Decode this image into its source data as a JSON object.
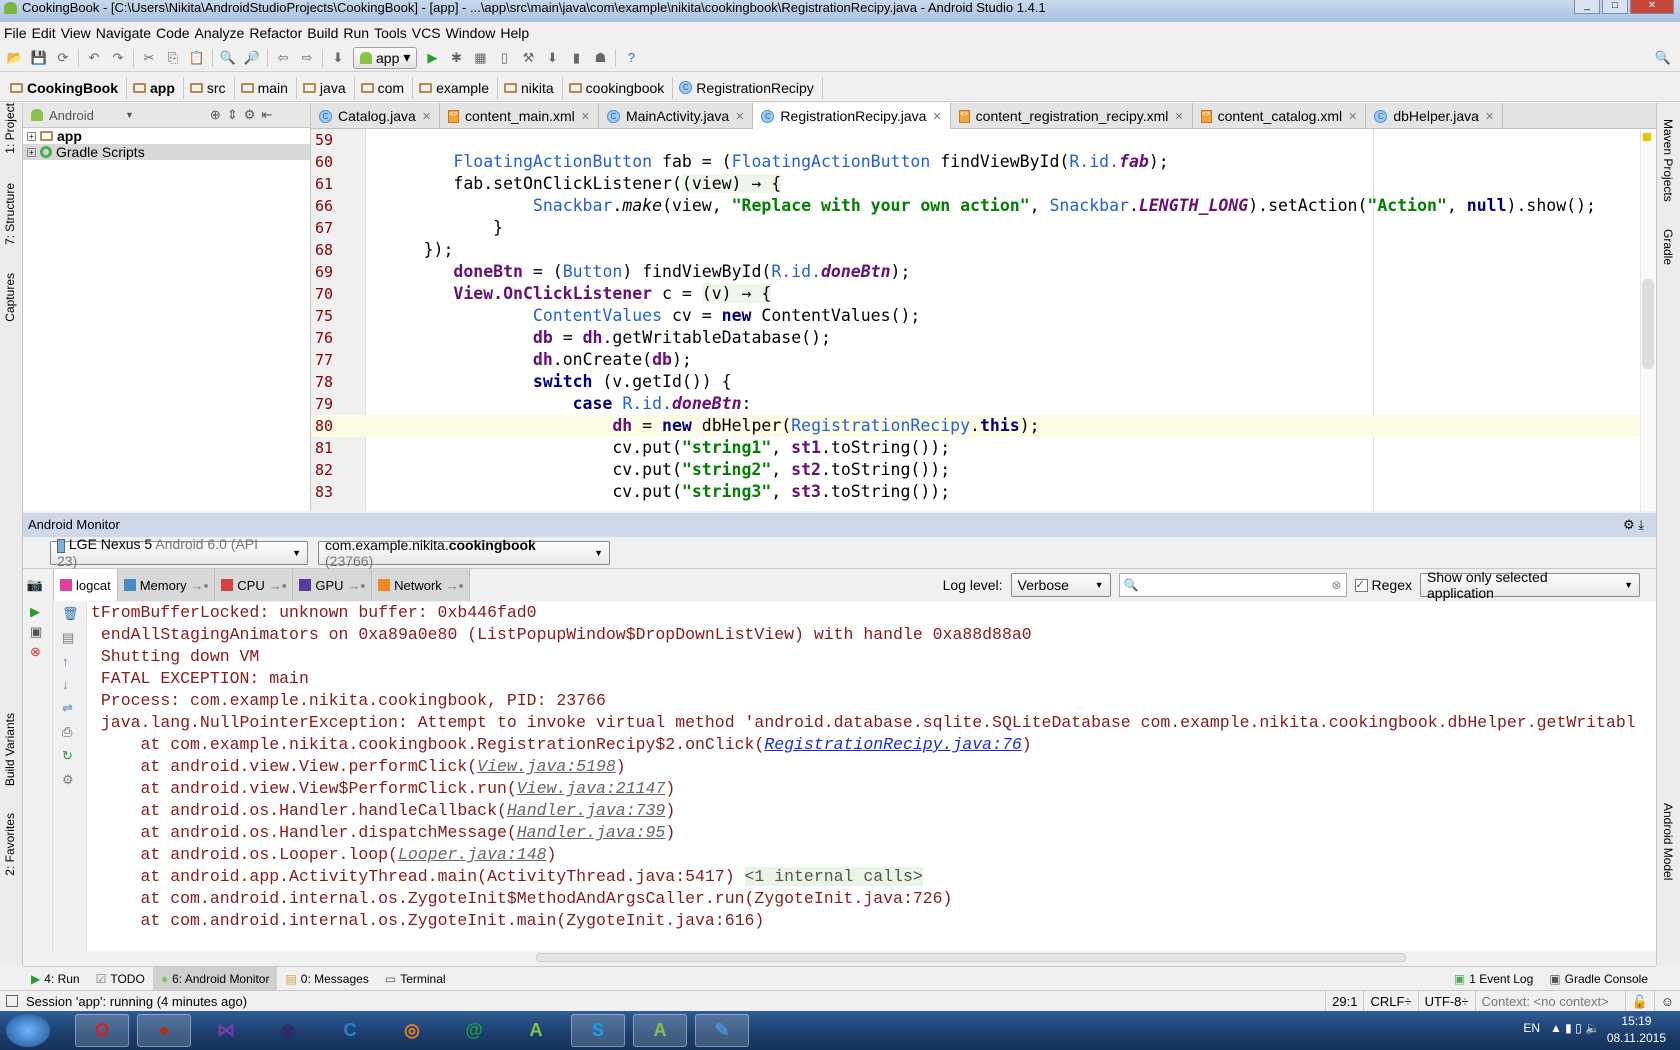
{
  "window": {
    "title": "CookingBook - [C:\\Users\\Nikita\\AndroidStudioProjects\\CookingBook] - [app] - ...\\app\\src\\main\\java\\com\\example\\nikita\\cookingbook\\RegistrationRecipy.java - Android Studio 1.4.1"
  },
  "menu": [
    "File",
    "Edit",
    "View",
    "Navigate",
    "Code",
    "Analyze",
    "Refactor",
    "Build",
    "Run",
    "Tools",
    "VCS",
    "Window",
    "Help"
  ],
  "toolbar": {
    "run_config": "app",
    "icons": [
      "open-icon",
      "save-icon",
      "sync-icon",
      "undo-icon",
      "redo-icon",
      "cut-icon",
      "copy-icon",
      "paste-icon",
      "find-icon",
      "replace-icon",
      "back-icon",
      "forward-icon",
      "make-icon",
      "run-icon",
      "debug-icon",
      "coverage-icon",
      "attach-debugger-icon",
      "project-structure-icon",
      "sdk-manager-icon",
      "avd-manager-icon",
      "android-device-monitor-icon",
      "help-icon"
    ]
  },
  "breadcrumb": [
    {
      "label": "CookingBook",
      "bold": true,
      "icon": "folder"
    },
    {
      "label": "app",
      "bold": true,
      "icon": "folder"
    },
    {
      "label": "src",
      "icon": "folder"
    },
    {
      "label": "main",
      "icon": "folder"
    },
    {
      "label": "java",
      "icon": "folder"
    },
    {
      "label": "com",
      "icon": "folder"
    },
    {
      "label": "example",
      "icon": "folder"
    },
    {
      "label": "nikita",
      "icon": "folder"
    },
    {
      "label": "cookingbook",
      "icon": "folder"
    },
    {
      "label": "RegistrationRecipy",
      "icon": "class"
    }
  ],
  "left_strip": [
    "1: Project",
    "7: Structure",
    "Captures",
    "Build Variants",
    "2: Favorites"
  ],
  "right_strip": [
    "Maven Projects",
    "Gradle",
    "Android Model"
  ],
  "project": {
    "view_mode": "Android",
    "tree": [
      {
        "label": "app",
        "bold": true
      },
      {
        "label": "Gradle Scripts"
      }
    ]
  },
  "tabs": [
    {
      "label": "Catalog.java",
      "icon": "class"
    },
    {
      "label": "content_main.xml",
      "icon": "xml"
    },
    {
      "label": "MainActivity.java",
      "icon": "class"
    },
    {
      "label": "RegistrationRecipy.java",
      "icon": "class",
      "active": true
    },
    {
      "label": "content_registration_recipy.xml",
      "icon": "xml"
    },
    {
      "label": "content_catalog.xml",
      "icon": "xml"
    },
    {
      "label": "dbHelper.java",
      "icon": "class"
    }
  ],
  "editor": {
    "current_line": "80",
    "lines": [
      {
        "n": "59",
        "t": []
      },
      {
        "n": "60",
        "t": [
          [
            "",
            "         "
          ],
          [
            "type",
            "FloatingActionButton"
          ],
          [
            "",
            " fab = ("
          ],
          [
            "type",
            "FloatingActionButton"
          ],
          [
            "",
            " findViewById("
          ],
          [
            "type",
            "R.id."
          ],
          [
            "sfield",
            "fab"
          ],
          [
            "",
            ");"
          ]
        ]
      },
      {
        "n": "61",
        "t": [
          [
            "",
            "         fab.setOnClickListener("
          ],
          [
            "lambda",
            "(view) → {"
          ]
        ]
      },
      {
        "n": "66",
        "t": [
          [
            "",
            "                 "
          ],
          [
            "type",
            "Snackbar"
          ],
          [
            "",
            "."
          ],
          [
            "italic",
            "make"
          ],
          [
            "",
            "(view, "
          ],
          [
            "str",
            "\"Replace with your own action\""
          ],
          [
            "",
            ", "
          ],
          [
            "type",
            "Snackbar"
          ],
          [
            "",
            "."
          ],
          [
            "sfield",
            "LENGTH_LONG"
          ],
          [
            "",
            ").setAction("
          ],
          [
            "str",
            "\"Action\""
          ],
          [
            "",
            ", "
          ],
          [
            "kw",
            "null"
          ],
          [
            "",
            ").show();"
          ]
        ]
      },
      {
        "n": "67",
        "t": [
          [
            "",
            "             }"
          ]
        ]
      },
      {
        "n": "68",
        "t": [
          [
            "",
            "      });"
          ]
        ]
      },
      {
        "n": "69",
        "t": [
          [
            "",
            "         "
          ],
          [
            "field",
            "doneBtn"
          ],
          [
            "",
            " = ("
          ],
          [
            "type",
            "Button"
          ],
          [
            "",
            ") findViewById("
          ],
          [
            "type",
            "R.id."
          ],
          [
            "sfield",
            "doneBtn"
          ],
          [
            "",
            ");"
          ]
        ]
      },
      {
        "n": "70",
        "t": [
          [
            "",
            "         "
          ],
          [
            "field",
            "View.OnClickListener"
          ],
          [
            "",
            " c = "
          ],
          [
            "lambda",
            "(v) → {"
          ]
        ]
      },
      {
        "n": "75",
        "t": [
          [
            "",
            "                 "
          ],
          [
            "type",
            "ContentValues"
          ],
          [
            "",
            " cv = "
          ],
          [
            "kw",
            "new"
          ],
          [
            "",
            " ContentValues();"
          ]
        ]
      },
      {
        "n": "76",
        "t": [
          [
            "",
            "                 "
          ],
          [
            "field",
            "db"
          ],
          [
            "",
            " = "
          ],
          [
            "field",
            "dh"
          ],
          [
            "",
            ".getWritableDatabase();"
          ]
        ]
      },
      {
        "n": "77",
        "t": [
          [
            "",
            "                 "
          ],
          [
            "field",
            "dh"
          ],
          [
            "",
            ".onCreate("
          ],
          [
            "field",
            "db"
          ],
          [
            "",
            ");"
          ]
        ]
      },
      {
        "n": "78",
        "t": [
          [
            "",
            "                 "
          ],
          [
            "kw",
            "switch"
          ],
          [
            "",
            " (v.getId()) {"
          ]
        ]
      },
      {
        "n": "79",
        "t": [
          [
            "",
            "                     "
          ],
          [
            "kw",
            "case"
          ],
          [
            "",
            " "
          ],
          [
            "type",
            "R.id."
          ],
          [
            "sfield",
            "doneBtn"
          ],
          [
            "",
            ":"
          ]
        ]
      },
      {
        "n": "80",
        "t": [
          [
            "",
            "                         "
          ],
          [
            "field",
            "dh"
          ],
          [
            "",
            " = "
          ],
          [
            "kw",
            "new"
          ],
          [
            "",
            " dbHelper("
          ],
          [
            "type",
            "RegistrationRecipy"
          ],
          [
            "",
            "."
          ],
          [
            "kw",
            "this"
          ],
          [
            "",
            ");"
          ]
        ]
      },
      {
        "n": "81",
        "t": [
          [
            "",
            "                         cv.put("
          ],
          [
            "str",
            "\"string1\""
          ],
          [
            "",
            ", "
          ],
          [
            "field",
            "st1"
          ],
          [
            "",
            ".toString());"
          ]
        ]
      },
      {
        "n": "82",
        "t": [
          [
            "",
            "                         cv.put("
          ],
          [
            "str",
            "\"string2\""
          ],
          [
            "",
            ", "
          ],
          [
            "field",
            "st2"
          ],
          [
            "",
            ".toString());"
          ]
        ]
      },
      {
        "n": "83",
        "t": [
          [
            "",
            "                         cv.put("
          ],
          [
            "str",
            "\"string3\""
          ],
          [
            "",
            ", "
          ],
          [
            "field",
            "st3"
          ],
          [
            "",
            ".toString());"
          ]
        ]
      }
    ]
  },
  "monitor": {
    "title": "Android Monitor",
    "device": {
      "name": "LGE Nexus 5",
      "detail": "Android 6.0 (API 23)"
    },
    "process": {
      "prefix": "com.example.nikita.",
      "bold": "cookingbook",
      "pid": "(23766)"
    },
    "tabs": [
      {
        "label": "logcat",
        "color": "#e040a0",
        "active": true
      },
      {
        "label": "Memory",
        "color": "#4a8ac4"
      },
      {
        "label": "CPU",
        "color": "#d84040"
      },
      {
        "label": "GPU",
        "color": "#5a3aa0"
      },
      {
        "label": "Network",
        "color": "#f5871f"
      }
    ],
    "log_level_label": "Log level:",
    "log_level": "Verbose",
    "search_value": "",
    "regex_label": "Regex",
    "regex_checked": true,
    "filter": "Show only selected application",
    "log": [
      {
        "t": [
          [
            "",
            "tFromBufferLocked: unknown buffer: 0xb446fad0"
          ]
        ],
        "indent": ""
      },
      {
        "t": [
          [
            "",
            "endAllStagingAnimators on 0xa89a0e80 (ListPopupWindow$DropDownListView) with handle 0xa88d88a0"
          ]
        ],
        "indent": " "
      },
      {
        "t": [
          [
            "",
            "Shutting down VM"
          ]
        ],
        "indent": " "
      },
      {
        "t": [
          [
            "",
            "FATAL EXCEPTION: main"
          ]
        ],
        "indent": " "
      },
      {
        "t": [
          [
            "",
            "Process: com.example.nikita.cookingbook, PID: 23766"
          ]
        ],
        "indent": " "
      },
      {
        "t": [
          [
            "",
            "java.lang.NullPointerException: Attempt to invoke virtual method 'android.database.sqlite.SQLiteDatabase com.example.nikita.cookingbook.dbHelper.getWritabl"
          ]
        ],
        "indent": " "
      },
      {
        "t": [
          [
            "",
            "at com.example.nikita.cookingbook.RegistrationRecipy$2.onClick("
          ],
          [
            "bluelink",
            "RegistrationRecipy.java:76"
          ],
          [
            "",
            ")"
          ]
        ],
        "indent": "     "
      },
      {
        "t": [
          [
            "",
            "at android.view.View.performClick("
          ],
          [
            "link",
            "View.java:5198"
          ],
          [
            "",
            ")"
          ]
        ],
        "indent": "     "
      },
      {
        "t": [
          [
            "",
            "at android.view.View$PerformClick.run("
          ],
          [
            "link",
            "View.java:21147"
          ],
          [
            "",
            ")"
          ]
        ],
        "indent": "     "
      },
      {
        "t": [
          [
            "",
            "at android.os.Handler.handleCallback("
          ],
          [
            "link",
            "Handler.java:739"
          ],
          [
            "",
            ")"
          ]
        ],
        "indent": "     "
      },
      {
        "t": [
          [
            "",
            "at android.os.Handler.dispatchMessage("
          ],
          [
            "link",
            "Handler.java:95"
          ],
          [
            "",
            ")"
          ]
        ],
        "indent": "     "
      },
      {
        "t": [
          [
            "",
            "at android.os.Looper.loop("
          ],
          [
            "link",
            "Looper.java:148"
          ],
          [
            "",
            ")"
          ]
        ],
        "indent": "     "
      },
      {
        "t": [
          [
            "",
            "at android.app.ActivityThread.main(ActivityThread.java:5417) "
          ],
          [
            "internal",
            "<1 internal calls>"
          ]
        ],
        "indent": "     "
      },
      {
        "t": [
          [
            "",
            "at com.android.internal.os.ZygoteInit$MethodAndArgsCaller.run(ZygoteInit.java:726)"
          ]
        ],
        "indent": "     "
      },
      {
        "t": [
          [
            "",
            "at com.android.internal.os.ZygoteInit.main(ZygoteInit.java:616)"
          ]
        ],
        "indent": "     "
      }
    ]
  },
  "toolwindows": {
    "left": [
      {
        "label": "4: Run"
      },
      {
        "label": "TODO"
      },
      {
        "label": "6: Android Monitor",
        "active": true
      },
      {
        "label": "0: Messages"
      },
      {
        "label": "Terminal"
      }
    ],
    "right": [
      {
        "label": "1 Event Log"
      },
      {
        "label": "Gradle Console"
      }
    ]
  },
  "status": {
    "message": "Session 'app': running (4 minutes ago)",
    "position": "29:1",
    "line_sep": "CRLF÷",
    "encoding": "UTF-8÷",
    "context": "Context: <no context>"
  },
  "taskbar": {
    "apps": [
      "Opera",
      "Game",
      "Visual Studio",
      "Eclipse",
      "Chrome-like",
      "Blender",
      "Mail",
      "Android Studio",
      "Skype",
      "Android Studio",
      "Paint"
    ],
    "lang": "EN",
    "time": "15:19",
    "date": "08.11.2015"
  }
}
